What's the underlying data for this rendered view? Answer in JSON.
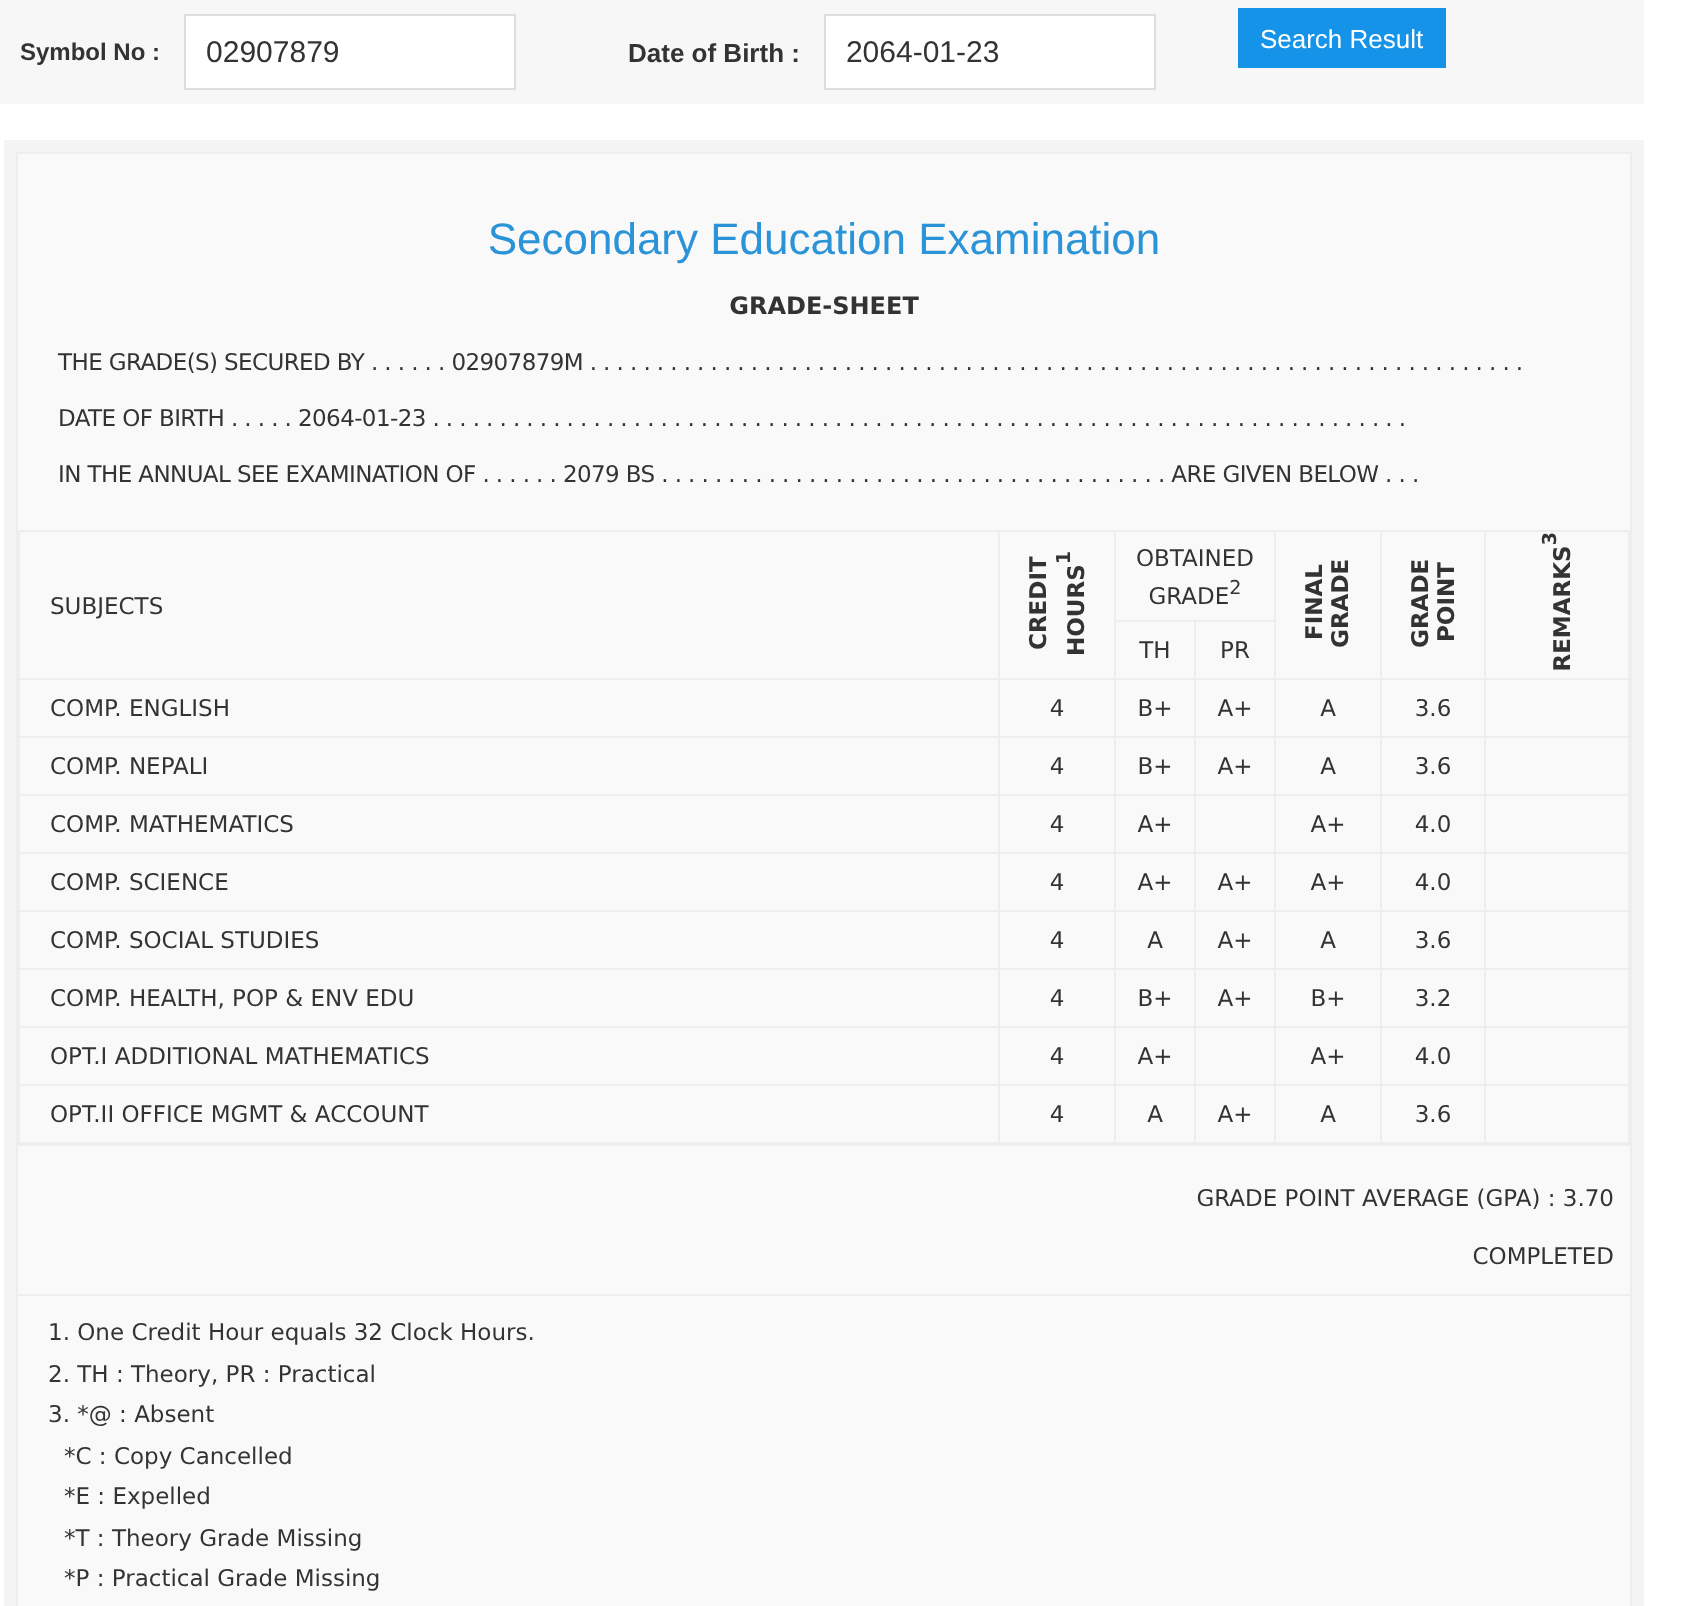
{
  "search_form": {
    "symbol_label": "Symbol No :",
    "symbol_value": "02907879",
    "dob_label": "Date of Birth :",
    "dob_value": "2064-01-23",
    "button": "Search Result"
  },
  "sheet": {
    "title": "Secondary Education Examination",
    "subtitle": "GRADE-SHEET",
    "info_lines": [
      "THE GRADE(S) SECURED BY . . . . . . 02907879M . . . . . . . . . . . . . . . . . . . . . . . . . . . . . . . . . . . . . . . . . . . . . . . . . . . . . . . . . . . . . . . . . . . . . .",
      "DATE OF BIRTH . . . . . 2064-01-23 . . . . . . . . . . . . . . . . . . . . . . . . . . . . . . . . . . . . . . . . . . . . . . . . . . . . . . . . . . . . . . . . . . . . . . . . .",
      "IN THE ANNUAL SEE EXAMINATION OF . . . . . . 2079 BS . . . . . . . . . . . . . . . . . . . . . . . . . . . . . . . . . . . . . . ARE GIVEN BELOW . . ."
    ]
  },
  "table": {
    "columns": {
      "subjects": "SUBJECTS",
      "credit_hours": "CREDIT HOURS$^{1}$",
      "obtained_grade": "OBTAINED GRADE$^{2}$",
      "th": "TH",
      "pr": "PR",
      "final_grade": "FINAL GRADE",
      "grade_point": "GRADE POINT",
      "remarks": "REMARKS$^{3}$"
    },
    "rows": [
      {
        "subject": "COMP. ENGLISH",
        "credit": "4",
        "th": "B+",
        "pr": "A+",
        "final": "A",
        "point": "3.6"
      },
      {
        "subject": "COMP. NEPALI",
        "credit": "4",
        "th": "B+",
        "pr": "A+",
        "final": "A",
        "point": "3.6"
      },
      {
        "subject": "COMP. MATHEMATICS",
        "credit": "4",
        "th": "A+",
        "final": "A+",
        "point": "4.0"
      },
      {
        "subject": "COMP. SCIENCE",
        "credit": "4",
        "th": "A+",
        "pr": "A+",
        "final": "A+",
        "point": "4.0"
      },
      {
        "subject": "COMP. SOCIAL STUDIES",
        "credit": "4",
        "th": "A",
        "pr": "A+",
        "final": "A",
        "point": "3.6"
      },
      {
        "subject": "COMP. HEALTH, POP & ENV EDU",
        "credit": "4",
        "th": "B+",
        "pr": "A+",
        "final": "B+",
        "point": "3.2"
      },
      {
        "subject": "OPT.I ADDITIONAL MATHEMATICS",
        "credit": "4",
        "th": "A+",
        "final": "A+",
        "point": "4.0"
      },
      {
        "subject": "OPT.II OFFICE MGMT & ACCOUNT",
        "credit": "4",
        "th": "A",
        "pr": "A+",
        "final": "A",
        "point": "3.6"
      }
    ],
    "gpa": "GRADE POINT AVERAGE (GPA) : 3.70",
    "status": "COMPLETED"
  },
  "notes": [
    "1. One Credit Hour equals 32 Clock Hours.",
    "2. TH : Theory, PR : Practical",
    "3. *@ : Absent",
    "*C : Copy Cancelled",
    "*E : Expelled",
    "*T : Theory Grade Missing",
    "*P : Practical Grade Missing"
  ]
}
